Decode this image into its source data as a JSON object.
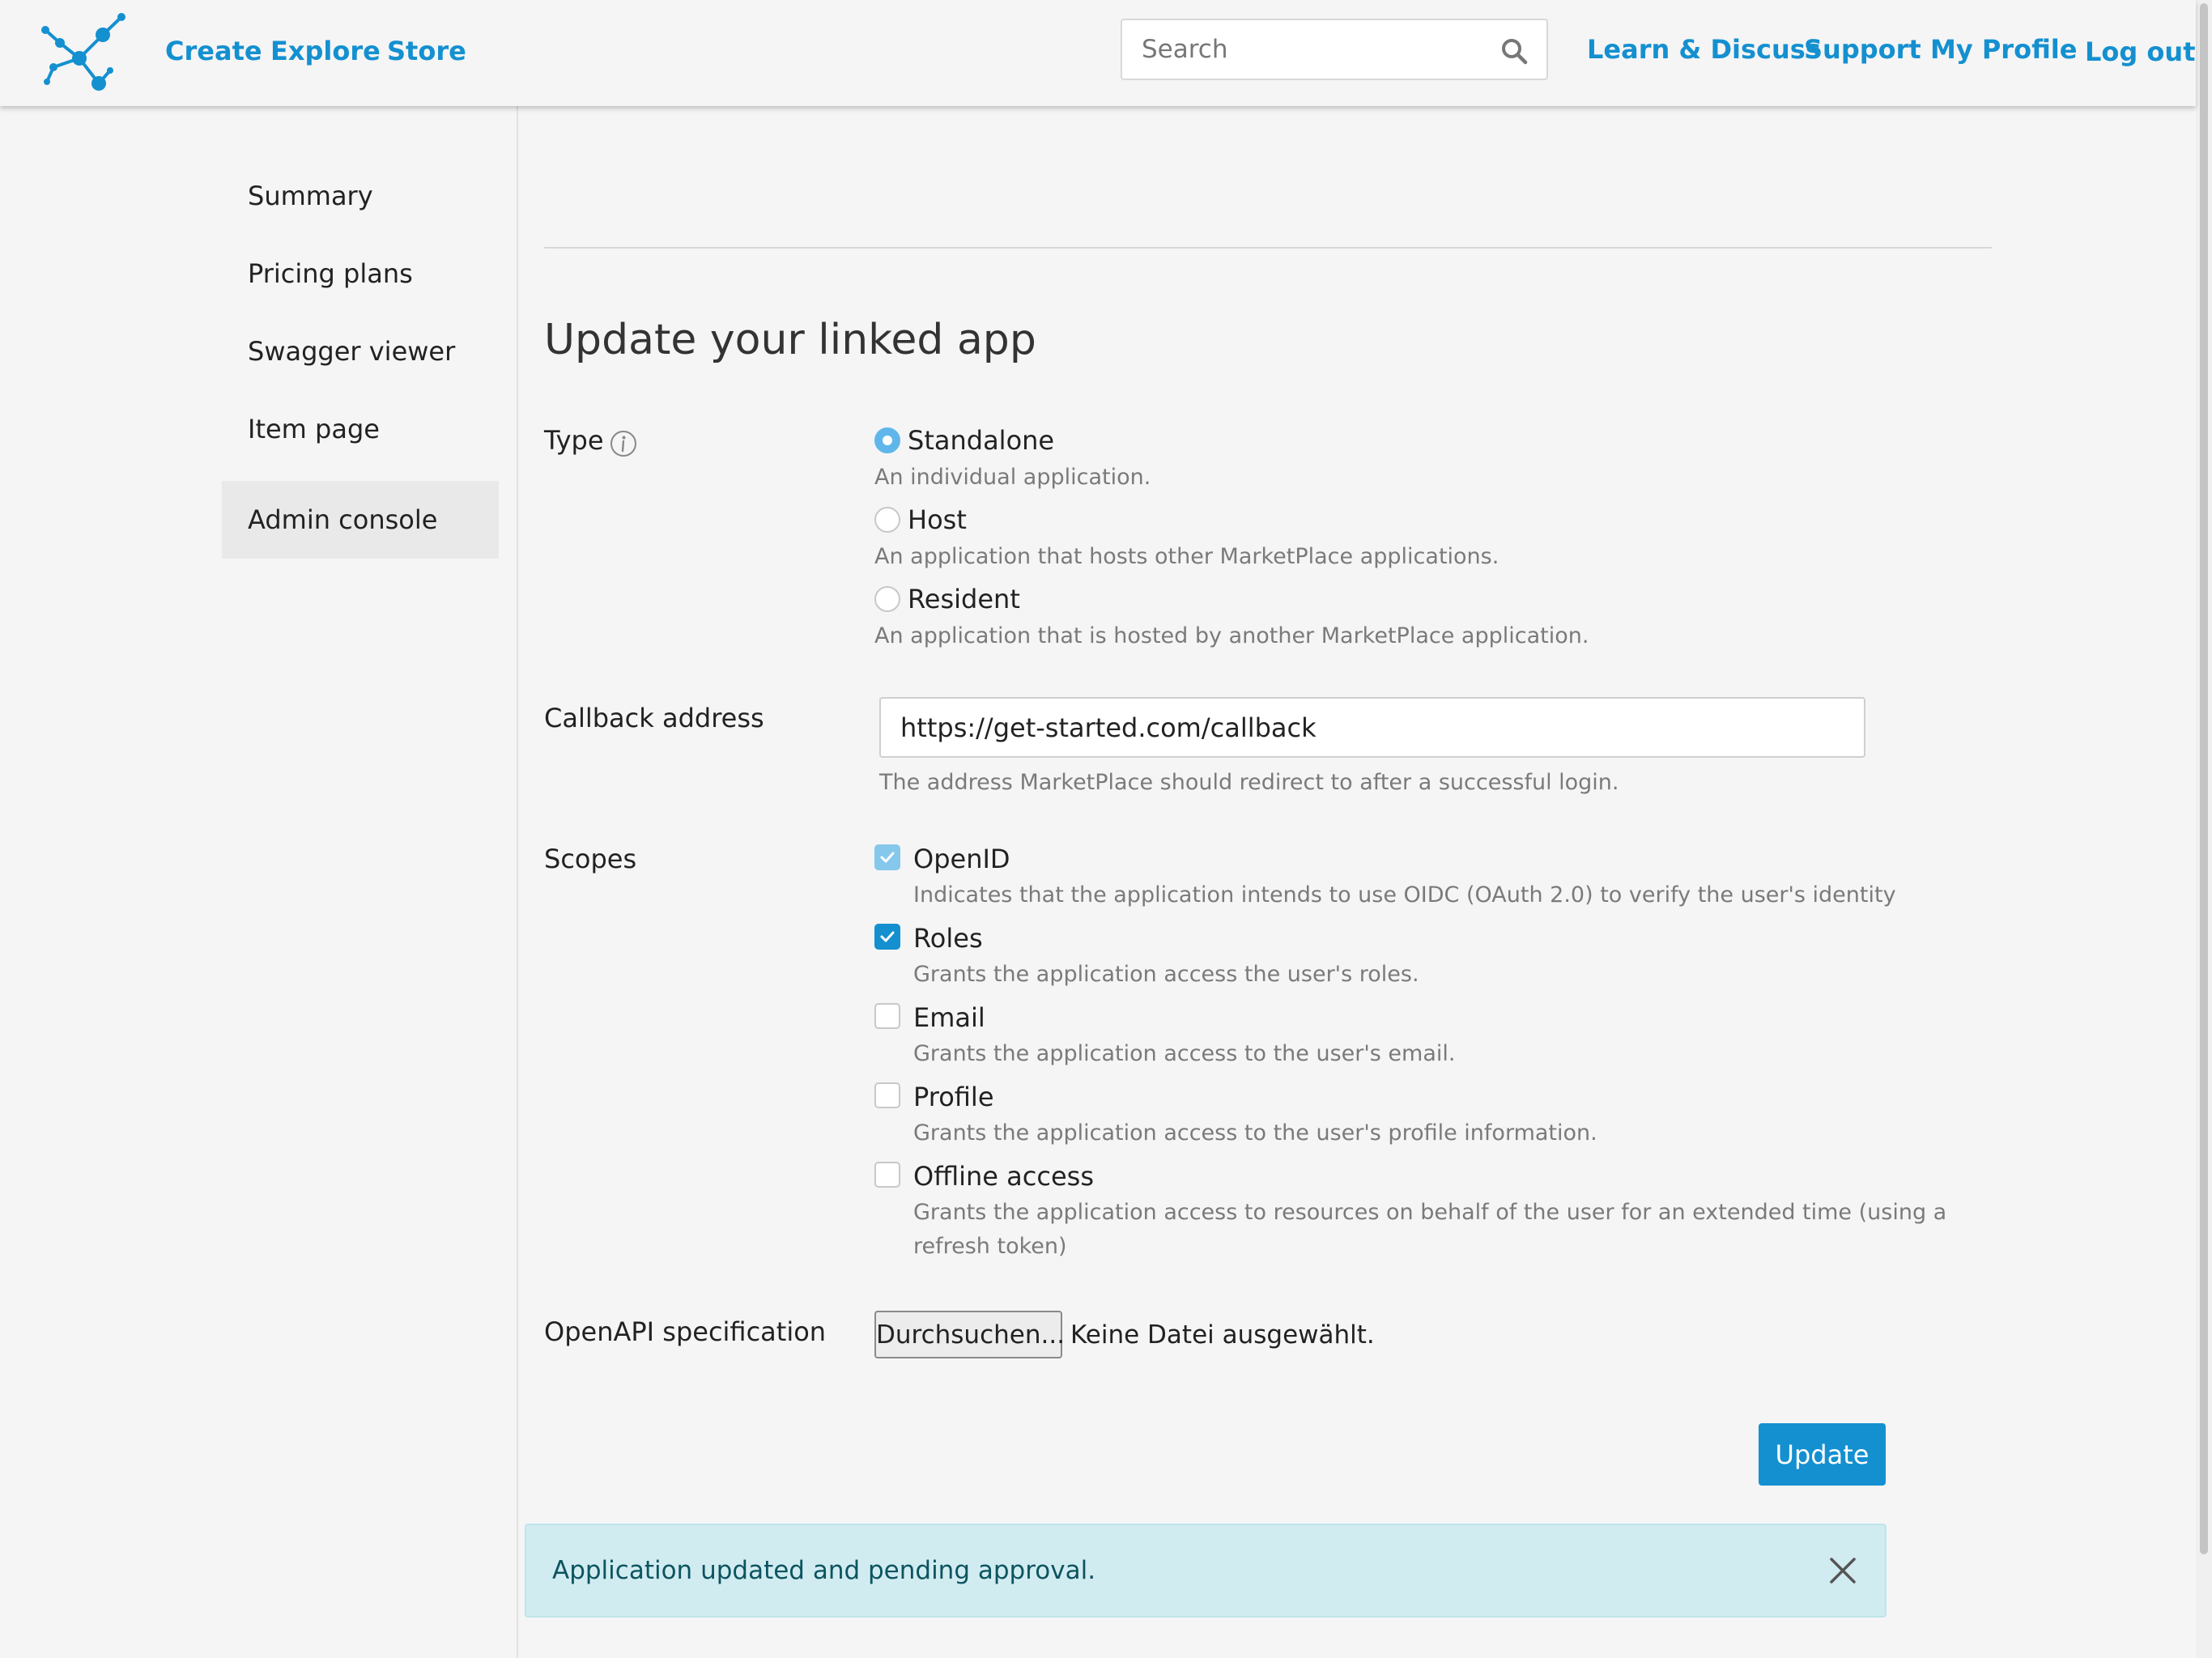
{
  "header": {
    "nav": [
      "Create",
      "Explore",
      "Store"
    ],
    "search_placeholder": "Search",
    "right_links": [
      "Learn & Discuss",
      "Support",
      "My Profile",
      "Log out"
    ]
  },
  "sidebar": {
    "items": [
      {
        "label": "Summary",
        "active": false
      },
      {
        "label": "Pricing plans",
        "active": false
      },
      {
        "label": "Swagger viewer",
        "active": false
      },
      {
        "label": "Item page",
        "active": false
      },
      {
        "label": "Admin console",
        "active": true
      }
    ]
  },
  "form": {
    "title": "Update your linked app",
    "type": {
      "label": "Type",
      "options": [
        {
          "label": "Standalone",
          "help": "An individual application.",
          "selected": true
        },
        {
          "label": "Host",
          "help": "An application that hosts other MarketPlace applications.",
          "selected": false
        },
        {
          "label": "Resident",
          "help": "An application that is hosted by another MarketPlace application.",
          "selected": false
        }
      ]
    },
    "callback": {
      "label": "Callback address",
      "value": "https://get-started.com/callback",
      "help": "The address MarketPlace should redirect to after a successful login."
    },
    "scopes": {
      "label": "Scopes",
      "items": [
        {
          "label": "OpenID",
          "help": "Indicates that the application intends to use OIDC (OAuth 2.0) to verify the user's identity",
          "checked": true,
          "disabled": true
        },
        {
          "label": "Roles",
          "help": "Grants the application access the user's roles.",
          "checked": true,
          "disabled": false
        },
        {
          "label": "Email",
          "help": "Grants the application access to the user's email.",
          "checked": false,
          "disabled": false
        },
        {
          "label": "Profile",
          "help": "Grants the application access to the user's profile information.",
          "checked": false,
          "disabled": false
        },
        {
          "label": "Offline access",
          "help": "Grants the application access to resources on behalf of the user for an extended time (using a",
          "help2": "refresh token)",
          "checked": false,
          "disabled": false
        }
      ]
    },
    "openapi": {
      "label": "OpenAPI specification",
      "button": "Durchsuchen...",
      "status": "Keine Datei ausgewählt."
    },
    "update_label": "Update"
  },
  "alert": {
    "text": "Application updated and pending approval."
  },
  "colors": {
    "accent": "#1490d0",
    "alert_bg": "#d1ecf1",
    "alert_text": "#0c5460"
  }
}
